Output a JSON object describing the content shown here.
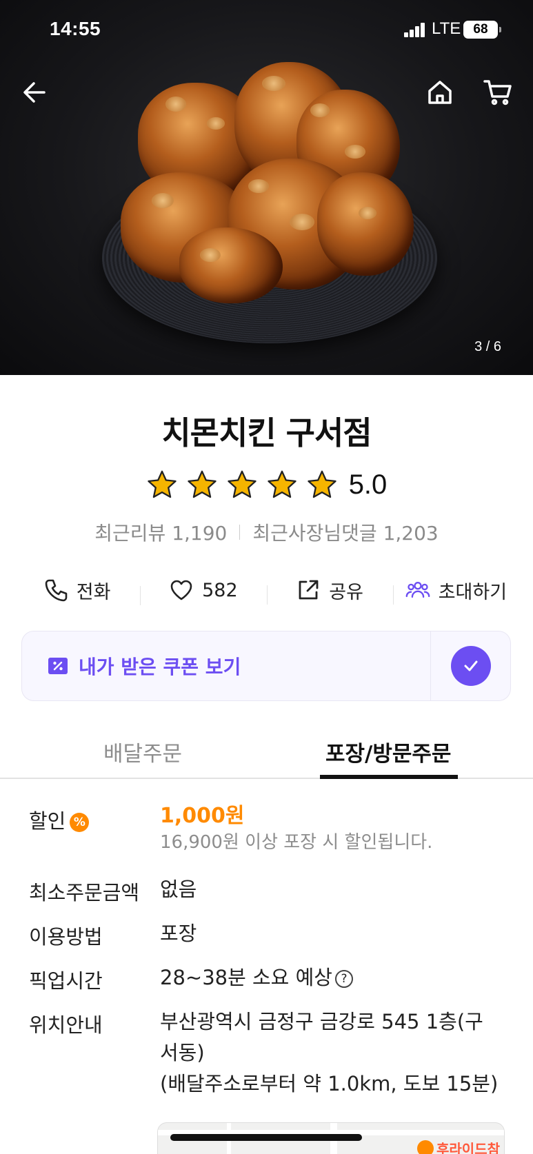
{
  "status_bar": {
    "time": "14:55",
    "network": "LTE",
    "battery": "68"
  },
  "hero": {
    "image_counter": "3 / 6"
  },
  "store": {
    "name": "치몬치킨 구서점",
    "rating": "5.0",
    "stars_filled": 5,
    "recent_reviews": "최근리뷰 1,190",
    "recent_owner_replies": "최근사장님댓글 1,203"
  },
  "actions": {
    "call_label": "전화",
    "like_count": "582",
    "share_label": "공유",
    "invite_label": "초대하기"
  },
  "coupon": {
    "label": "내가 받은 쿠폰 보기"
  },
  "tabs": [
    {
      "label": "배달주문",
      "active": false
    },
    {
      "label": "포장/방문주문",
      "active": true
    }
  ],
  "info": {
    "discount_key": "할인",
    "discount_badge": "%",
    "discount_amount": "1,000원",
    "discount_note": "16,900원 이상 포장 시 할인됩니다.",
    "min_order_key": "최소주문금액",
    "min_order_value": "없음",
    "method_key": "이용방법",
    "method_value": "포장",
    "pickup_key": "픽업시간",
    "pickup_value": "28~38분 소요 예상",
    "location_key": "위치안내",
    "location_line1": "부산광역시 금정구 금강로 545 1층(구",
    "location_line2": "서동)",
    "location_line3": "(배달주소로부터 약 1.0km, 도보 15분)"
  },
  "map": {
    "poi_label": "후라이드참"
  },
  "colors": {
    "accent": "#6c4ef2",
    "discount": "#ff8a00",
    "star": "#f5b400"
  }
}
